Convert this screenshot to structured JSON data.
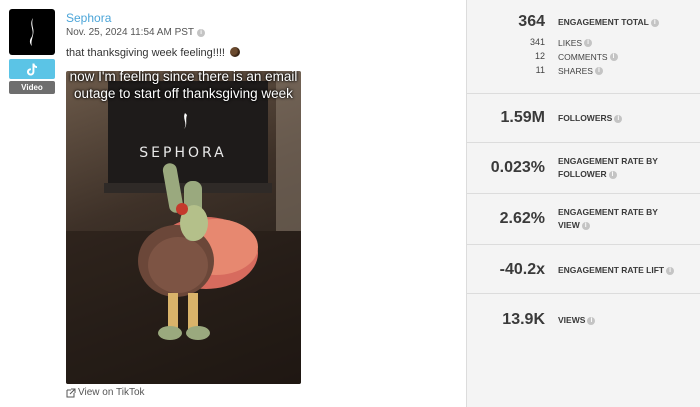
{
  "post": {
    "account_name": "Sephora",
    "timestamp": "Nov. 25, 2024 11:54 AM PST",
    "caption": "that thanksgiving week feeling!!!!",
    "media_overlay_text": "now I'm feeling since there is an email outage to start off thanksgiving week",
    "media_brand_text": "SEPHORA",
    "media_type_tag": "Video",
    "platform_icon": "tiktok-icon",
    "view_link": "View on TikTok"
  },
  "metrics": {
    "engagement_total": {
      "value": "364",
      "label": "ENGAGEMENT TOTAL"
    },
    "likes": {
      "value": "341",
      "label": "LIKES"
    },
    "comments": {
      "value": "12",
      "label": "COMMENTS"
    },
    "shares": {
      "value": "11",
      "label": "SHARES"
    },
    "followers": {
      "value": "1.59M",
      "label": "FOLLOWERS"
    },
    "engagement_rate_follower": {
      "value": "0.023%",
      "label_line1": "ENGAGEMENT RATE BY",
      "label_line2": "FOLLOWER"
    },
    "engagement_rate_view": {
      "value": "2.62%",
      "label_line1": "ENGAGEMENT RATE BY",
      "label_line2": "VIEW"
    },
    "engagement_rate_lift": {
      "value": "-40.2x",
      "label": "ENGAGEMENT RATE LIFT"
    },
    "views": {
      "value": "13.9K",
      "label": "VIEWS"
    }
  },
  "colors": {
    "account_link": "#4ca5d8",
    "tiktok_badge": "#5bc4e6",
    "panel_bg": "#f4f4f4"
  }
}
